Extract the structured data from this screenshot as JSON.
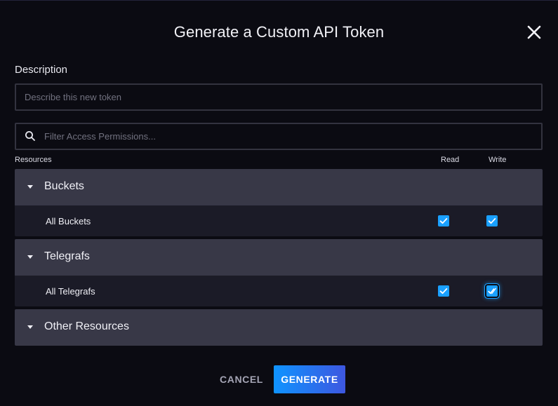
{
  "dialog": {
    "title": "Generate a Custom API Token",
    "close_icon": "close-icon"
  },
  "description": {
    "label": "Description",
    "placeholder": "Describe this new token",
    "value": ""
  },
  "filter": {
    "placeholder": "Filter Access Permissions...",
    "icon": "search-icon",
    "value": ""
  },
  "columns": {
    "resources": "Resources",
    "read": "Read",
    "write": "Write"
  },
  "groups": [
    {
      "name": "Buckets",
      "expanded": true,
      "rows": [
        {
          "name": "All Buckets",
          "read": true,
          "write": true
        }
      ]
    },
    {
      "name": "Telegrafs",
      "expanded": true,
      "rows": [
        {
          "name": "All Telegrafs",
          "read": true,
          "write": true
        }
      ]
    },
    {
      "name": "Other Resources",
      "expanded": false,
      "rows": []
    }
  ],
  "actions": {
    "cancel_label": "CANCEL",
    "generate_label": "GENERATE"
  },
  "colors": {
    "background": "#0b0b12",
    "group_header": "#383847",
    "group_row": "#1b1b27",
    "checkbox": "#1aa0ff",
    "generate_gradient_start": "#0f94ff",
    "generate_gradient_end": "#3d57e0"
  }
}
